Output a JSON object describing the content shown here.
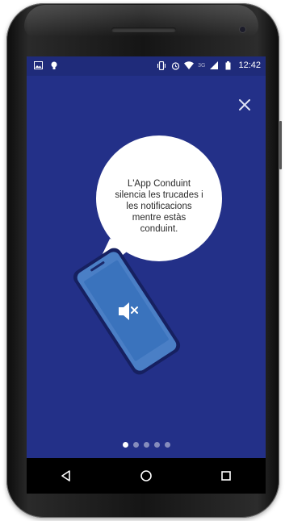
{
  "status_bar": {
    "left_icons": [
      "image-notification-icon",
      "bulb-notification-icon"
    ],
    "right_icons": [
      "vibrate-icon",
      "alarm-icon",
      "wifi-icon",
      "network-3g-icon",
      "signal-icon",
      "battery-icon"
    ],
    "network_label": "3G",
    "time": "12:42"
  },
  "onboarding": {
    "bubble_text": "L'App Conduint\nsilencia les trucades i\nles notificacions\nmentre estàs\nconduint.",
    "illustration_icon": "muted-speaker-icon",
    "close_icon": "close-icon"
  },
  "pager": {
    "total": 5,
    "current": 1
  },
  "navigation": {
    "buttons": [
      "back-icon",
      "home-icon",
      "recents-icon"
    ]
  },
  "colors": {
    "screen_background": "#233088",
    "status_bar": "#1f2b7a",
    "bubble": "#ffffff",
    "phone_illustration_screen": "#3f7fc4"
  }
}
